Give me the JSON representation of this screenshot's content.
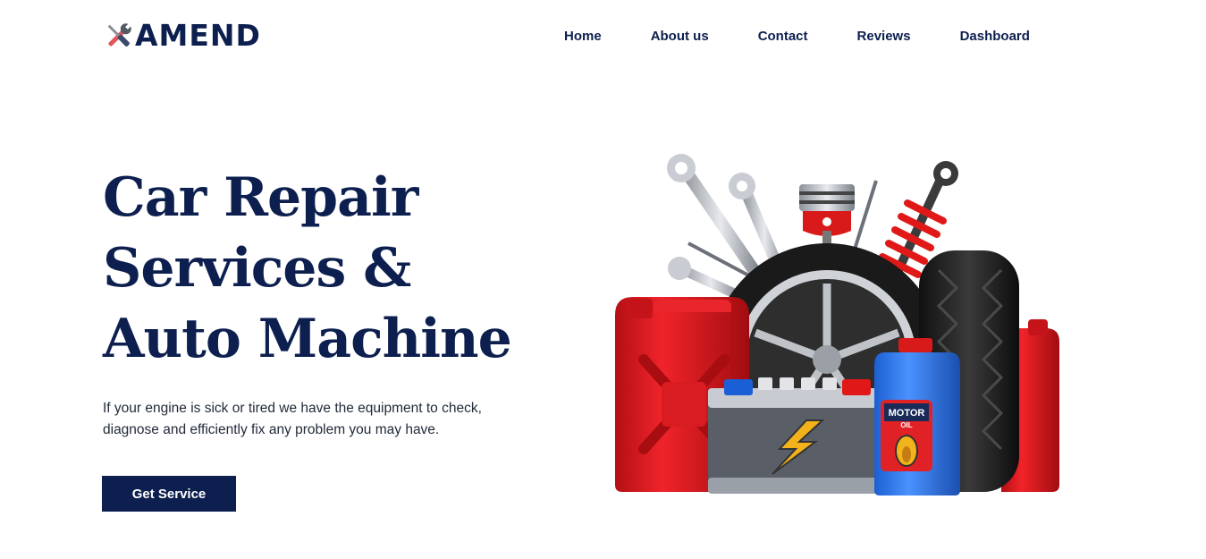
{
  "brand": {
    "name": "AMEND",
    "logo_icon": "tools-icon",
    "primary_color": "#0d1f4f",
    "accent_color": "#e02a2a"
  },
  "nav": {
    "items": [
      {
        "label": "Home"
      },
      {
        "label": "About us"
      },
      {
        "label": "Contact"
      },
      {
        "label": "Reviews"
      },
      {
        "label": "Dashboard"
      }
    ]
  },
  "hero": {
    "title_lines": [
      "Car Repair",
      "Services &",
      "Auto Machine"
    ],
    "description": "If your engine is sick or tired we have the equipment to check, diagnose and efficiently fix any problem you may have.",
    "cta_label": "Get Service",
    "illustration": {
      "name": "auto-parts-illustration",
      "battery_icon": "lightning-bolt-icon",
      "oil_label_top": "MOTOR",
      "oil_label_bottom": "OIL"
    }
  }
}
